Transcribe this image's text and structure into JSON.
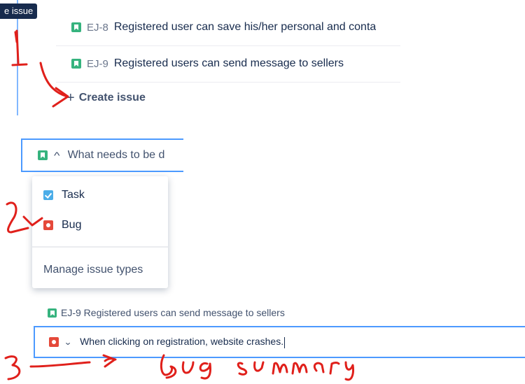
{
  "tooltip": "e issue",
  "backlog": {
    "rows": [
      {
        "key": "EJ-8",
        "summary": "Registered user can save his/her personal and conta",
        "icon": "story-icon"
      },
      {
        "key": "EJ-9",
        "summary": "Registered users can send message to sellers",
        "icon": "story-icon"
      }
    ],
    "create_issue": "Create issue",
    "plus": "+"
  },
  "type_picker": {
    "placeholder": "What needs to be d",
    "options": [
      {
        "label": "Task",
        "icon": "task-icon"
      },
      {
        "label": "Bug",
        "icon": "bug-icon"
      }
    ],
    "manage": "Manage issue types"
  },
  "bug_entry": {
    "prev_row": "EJ-9  Registered users can send message to sellers",
    "summary_value": "When clicking on registration, website crashes."
  },
  "annotations": {
    "step1": "1",
    "step2": "2",
    "step3": "3",
    "handwritten_label": "Bug summary",
    "color": "#e0201b"
  },
  "colors": {
    "focus_border": "#4c9aff",
    "story": "#36b37e",
    "bug": "#e5493a",
    "task": "#4bade8"
  }
}
